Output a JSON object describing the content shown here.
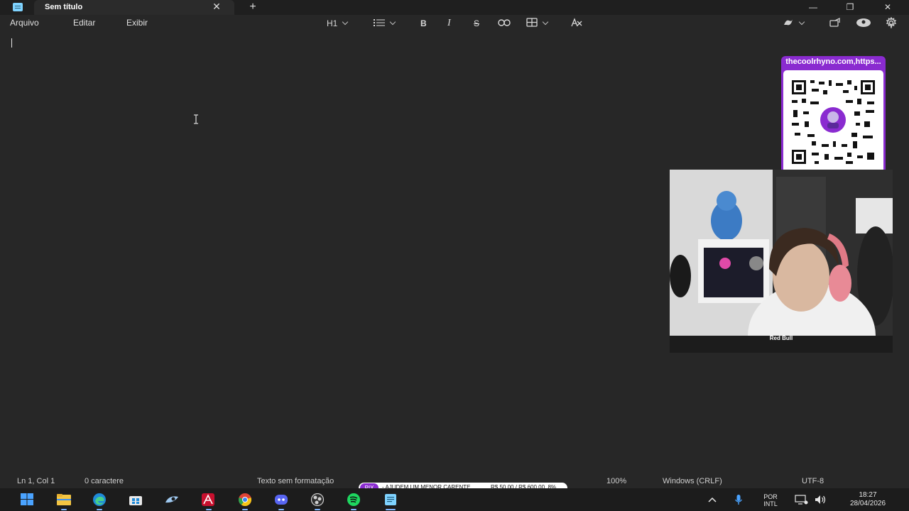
{
  "titlebar": {
    "tab_title": "Sem título",
    "close_tab": "✕",
    "new_tab": "+",
    "minimize": "—",
    "restore": "❐",
    "close": "✕"
  },
  "menu": [
    "Arquivo",
    "Editar",
    "Exibir"
  ],
  "toolbar": {
    "heading": "H1",
    "bold": "B",
    "italic": "I",
    "strikethrough": "S"
  },
  "overlay": {
    "qr_label": "thecoolrhyno.com,https...",
    "webcam_brand": "Red Bull"
  },
  "status": {
    "position": "Ln 1, Col 1",
    "chars": "0 caractere",
    "format": "Texto sem formatação",
    "zoom": "100%",
    "line_ending": "Windows (CRLF)",
    "encoding": "UTF-8"
  },
  "donation": {
    "badge": "PIX",
    "text": "- AJUDEM UM MENOR CARENTE.",
    "amount": "R$ 50,00 / R$ 600,00",
    "percent": "8%",
    "progress": 0.08
  },
  "taskbar": {
    "lang_top": "POR",
    "lang_bottom": "INTL",
    "time": "18:27",
    "date": "28/04/2026"
  },
  "icons": [
    "windows-icon",
    "file-explorer-icon",
    "edge-icon",
    "store-icon",
    "steam-icon",
    "acrobat-icon",
    "chrome-icon",
    "discord-icon",
    "obs-icon",
    "spotify-icon",
    "notepad-icon"
  ],
  "colors": {
    "accent": "#8a2bd0",
    "taskbar_active": "#7fb5ff"
  }
}
